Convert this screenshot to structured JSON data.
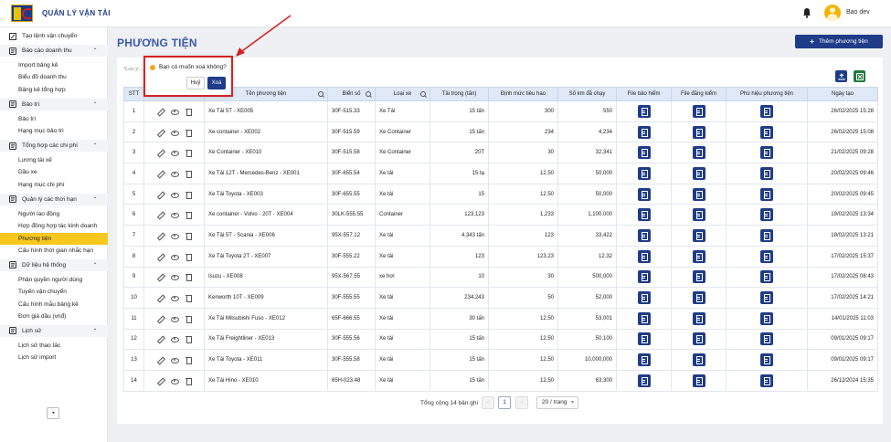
{
  "app": {
    "title": "QUẢN LÝ VẬN TẢI",
    "user": "Bao dev"
  },
  "sidebar": {
    "top_item": "Tạo lệnh vận chuyển",
    "groups": [
      {
        "label": "Báo cáo doanh thu",
        "items": [
          "Import bảng kê",
          "Biểu đồ doanh thu",
          "Bảng kê tổng hợp"
        ]
      },
      {
        "label": "Bảo trì",
        "items": [
          "Bảo trì",
          "Hạng mục bảo trì"
        ]
      },
      {
        "label": "Tổng hợp các chi phí",
        "items": [
          "Lương tài xế",
          "Dầu xe",
          "Hạng mục chi phí"
        ]
      },
      {
        "label": "Quản lý các thời hạn",
        "items": [
          "Người lao động",
          "Hợp đồng hợp tác kinh doanh",
          "Phương tiện",
          "Cấu hình thời gian nhắc hạn"
        ]
      },
      {
        "label": "Dữ liệu hệ thống",
        "items": [
          "Phân quyền người dùng",
          "Tuyến vận chuyển",
          "Cấu hình mẫu bảng kê",
          "Đơn giá dầu (vnđ)"
        ]
      },
      {
        "label": "Lịch sử",
        "items": [
          "Lịch sử thao tác",
          "Lịch sử import"
        ]
      }
    ],
    "active_item": "Phương tiện",
    "collapse_icon": "◂"
  },
  "page": {
    "title": "PHƯƠNG TIỆN",
    "add_button": "Thêm phương tiện",
    "note": "*Lưu ý: ... 00km)."
  },
  "popconfirm": {
    "message": "Bạn có muốn xoá không?",
    "cancel": "Huỷ",
    "ok": "Xoá"
  },
  "table": {
    "headers": [
      "STT",
      "",
      "Tên phương tiện",
      "Biển số",
      "Loại xe",
      "Tải trọng (tấn)",
      "Định mức tiêu hao",
      "Số km đã chạy",
      "File bảo hiểm",
      "File đăng kiểm",
      "Phù hiệu phương tiện",
      "Ngày tạo"
    ],
    "rows": [
      [
        "1",
        "Xe Tải 5T - XE005",
        "30F-515.33",
        "Xe Tải",
        "15 tấn",
        "300",
        "550",
        "26/02/2025 15:28"
      ],
      [
        "2",
        "Xe container - XE002",
        "30F-515.59",
        "Xe Container",
        "15 tấn",
        "234",
        "4,234",
        "26/02/2025 15:08"
      ],
      [
        "3",
        "Xe Container - XE010",
        "30F-515.58",
        "Xe Container",
        "20T",
        "30",
        "32,341",
        "21/02/2025 09:28"
      ],
      [
        "4",
        "Xe Tải 12T - Mercedes-Benz - XE001",
        "30F-655.54",
        "Xe tải",
        "15 tạ",
        "12.50",
        "50,000",
        "20/02/2025 09:46"
      ],
      [
        "5",
        "Xe Tải Toyota - XE003",
        "30F-655.55",
        "Xe tải",
        "15",
        "12.50",
        "50,000",
        "20/02/2025 09:45"
      ],
      [
        "6",
        "Xe container - Volvo - 20T - XE004",
        "30LK-555.55",
        "Container",
        "123,123",
        "1,233",
        "1,100,000",
        "19/02/2025 13:34"
      ],
      [
        "7",
        "Xe Tải 5T - Scania - XE006",
        "95X-557.12",
        "Xe tải",
        "4,343 tấn",
        "123",
        "33,422",
        "18/02/2025 13:21"
      ],
      [
        "8",
        "Xe Tải Toyota 2T - XE007",
        "30F-555.22",
        "Xe tải",
        "123",
        "123.23",
        "12.32",
        "17/02/2025 15:37"
      ],
      [
        "9",
        "Isuzu - XE008",
        "95X-567.55",
        "xe hơi",
        "10",
        "30",
        "500,000",
        "17/02/2025 08:43"
      ],
      [
        "10",
        "Kenworth 10T - XE009",
        "30F-555.55",
        "Xe tải",
        "234,243",
        "50",
        "52,000",
        "17/02/2025 14:21"
      ],
      [
        "11",
        "Xe Tải Mitsubishi Fuso - XE012",
        "65F-666.55",
        "Xe tải",
        "30 tấn",
        "12.50",
        "53,001",
        "14/01/2025 11:03"
      ],
      [
        "12",
        "Xe Tải Freightliner - XE013",
        "30F-555.56",
        "Xe tải",
        "15 tấn",
        "12.50",
        "50,100",
        "09/01/2025 09:17"
      ],
      [
        "13",
        "Xe Tải Toyota - XE011",
        "30F-555.58",
        "Xe tải",
        "15 tấn",
        "12.50",
        "10,000,000",
        "09/01/2025 09:17"
      ],
      [
        "14",
        "Xe Tải Hino - XE010",
        "65H-023.48",
        "Xe tải",
        "15 tấn",
        "12.50",
        "63,300",
        "26/12/2024 15:35"
      ]
    ]
  },
  "pagination": {
    "total_text": "Tổng cộng 14 bản ghi",
    "prev": "‹",
    "next": "›",
    "current": "1",
    "page_size": "20 / trang"
  },
  "colors": {
    "primary": "#1f3c88",
    "active": "#f8c81f",
    "excel": "#1e7b3e",
    "highlight": "#d42323"
  }
}
